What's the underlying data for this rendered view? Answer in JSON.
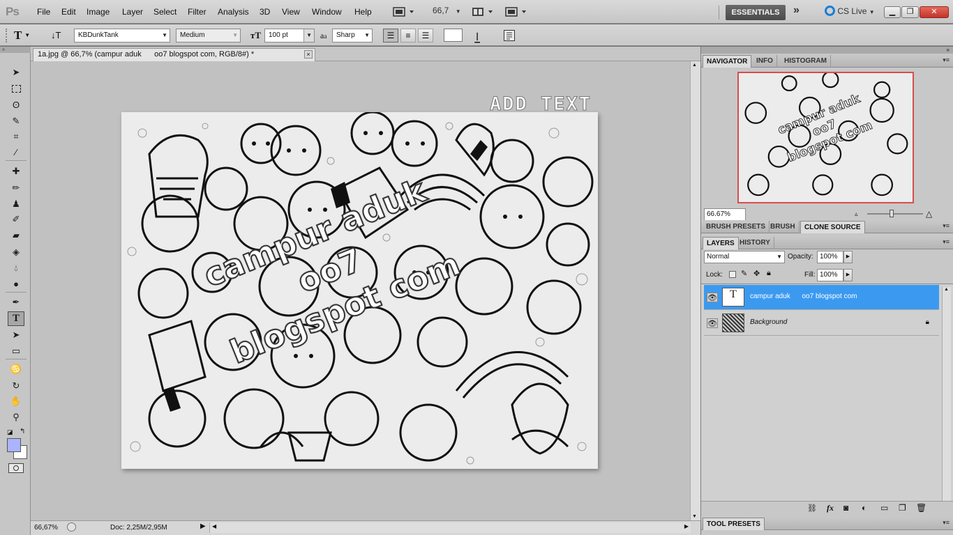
{
  "app": {
    "logo": "Ps",
    "menu": [
      "File",
      "Edit",
      "Image",
      "Layer",
      "Select",
      "Filter",
      "Analysis",
      "3D",
      "View",
      "Window",
      "Help"
    ],
    "zoom_dropdown": "66,7",
    "workspace": "ESSENTIALS",
    "workspace_more": "»",
    "cs_live": "CS Live"
  },
  "options": {
    "tool_glyph": "T",
    "font_family": "KBDunkTank",
    "font_style": "Medium",
    "font_size": "100 pt",
    "aa_label": "a",
    "aa_method": "Sharp"
  },
  "document": {
    "tab_title": "1a.jpg @ 66,7% (campur aduk      oo7 blogspot com, RGB/8#) *",
    "tab_close": "×",
    "image_text": {
      "watermark_title": "ADD TEXT",
      "line1": "campur aduk",
      "line2": "oo7",
      "line3": "blogspot com"
    }
  },
  "status": {
    "zoom": "66,67%",
    "doc_size": "Doc: 2,25M/2,95M"
  },
  "panels": {
    "navigator_tabs": [
      "NAVIGATOR",
      "INFO",
      "HISTOGRAM"
    ],
    "navigator_zoom": "66.67%",
    "navigator_thumb_text": [
      "campur aduk",
      "oo7",
      "blogspot com"
    ],
    "brush_tabs": [
      "BRUSH PRESETS",
      "BRUSH",
      "CLONE SOURCE"
    ],
    "layers_tabs": [
      "LAYERS",
      "HISTORY"
    ],
    "blend_mode": "Normal",
    "opacity_label": "Opacity:",
    "opacity": "100%",
    "lock_label": "Lock:",
    "fill_label": "Fill:",
    "fill": "100%",
    "layers": [
      {
        "name": "campur aduk      oo7 blogspot com",
        "thumb": "T",
        "selected": true
      },
      {
        "name": "Background",
        "thumb": "",
        "selected": false
      }
    ],
    "tool_presets": "TOOL PRESETS"
  },
  "colors": {
    "selected_layer": "#3b9af0",
    "navigator_frame": "#d84d4d",
    "foreground_swatch": "#aab4ff"
  },
  "icons": {
    "eye": "eye-icon",
    "lock": "lock-icon",
    "close": "close-icon"
  }
}
